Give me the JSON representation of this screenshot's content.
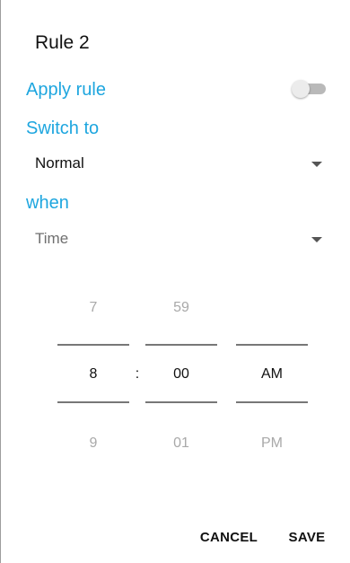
{
  "dialog": {
    "title": "Rule 2",
    "apply_rule_label": "Apply rule",
    "apply_rule_enabled": false,
    "switch_to_label": "Switch to",
    "switch_to_value": "Normal",
    "when_label": "when",
    "when_value": "Time"
  },
  "time_picker": {
    "hour": {
      "prev": "7",
      "selected": "8",
      "next": "9"
    },
    "separator": ":",
    "minute": {
      "prev": "59",
      "selected": "00",
      "next": "01"
    },
    "ampm": {
      "prev": "",
      "selected": "AM",
      "next": "PM"
    }
  },
  "buttons": {
    "cancel": "CANCEL",
    "save": "SAVE"
  },
  "colors": {
    "accent": "#1ea6df",
    "toggle_track_off": "#b9b9b9",
    "toggle_thumb_off": "#ececec"
  },
  "icons": {
    "dropdown_arrow": "triangle-down-icon"
  }
}
